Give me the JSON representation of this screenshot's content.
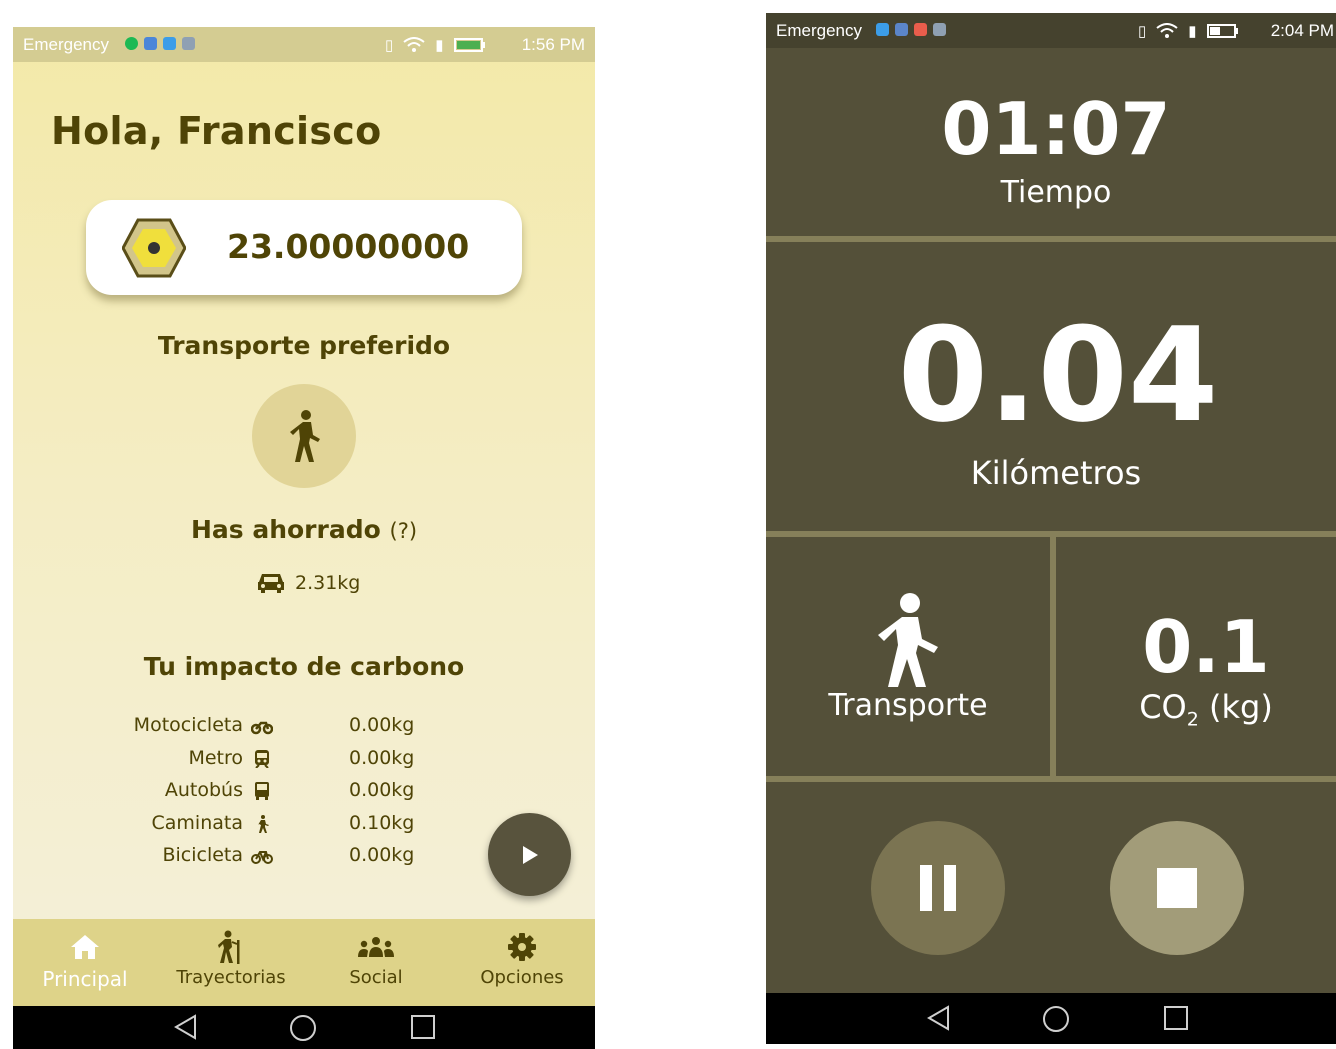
{
  "left_screen": {
    "status_bar": {
      "label": "Emergency",
      "time": "1:56 PM"
    },
    "greeting": "Hola, Francisco",
    "balance": {
      "value": "23.00000000",
      "icon": "honeycomb-coin-icon"
    },
    "preferred_transport": {
      "title": "Transporte preferido",
      "icon": "walking-icon"
    },
    "savings": {
      "title": "Has ahorrado",
      "help": "(?)",
      "value": "2.31kg",
      "icon": "car-icon"
    },
    "impact": {
      "title": "Tu impacto de carbono",
      "rows": [
        {
          "name": "Motocicleta",
          "icon": "motorcycle-icon",
          "value": "0.00kg"
        },
        {
          "name": "Metro",
          "icon": "subway-icon",
          "value": "0.00kg"
        },
        {
          "name": "Autobús",
          "icon": "bus-icon",
          "value": "0.00kg"
        },
        {
          "name": "Caminata",
          "icon": "walking-icon",
          "value": "0.10kg"
        },
        {
          "name": "Bicicleta",
          "icon": "bicycle-icon",
          "value": "0.00kg"
        }
      ]
    },
    "bottom_nav": [
      {
        "label": "Principal",
        "icon": "home-icon",
        "active": true
      },
      {
        "label": "Trayectorias",
        "icon": "hiker-icon",
        "active": false
      },
      {
        "label": "Social",
        "icon": "people-icon",
        "active": false
      },
      {
        "label": "Opciones",
        "icon": "gear-icon",
        "active": false
      }
    ],
    "colors": {
      "text": "#4f4406",
      "nav_bg": "#ded389",
      "fab": "#58533d",
      "active_label": "#ffffff"
    }
  },
  "right_screen": {
    "status_bar": {
      "label": "Emergency",
      "time": "2:04 PM"
    },
    "time": {
      "value": "01:07",
      "label": "Tiempo"
    },
    "distance": {
      "value": "0.04",
      "label": "Kilómetros"
    },
    "transport": {
      "label": "Transporte",
      "icon": "walking-icon"
    },
    "co2": {
      "value": "0.1",
      "label_prefix": "CO",
      "label_sub": "2",
      "label_suffix": " (kg)"
    },
    "controls": {
      "pause_icon": "pause-icon",
      "stop_icon": "stop-icon"
    },
    "colors": {
      "bg": "#545039",
      "divider": "#86805a",
      "pause_btn": "#7b7452",
      "stop_btn": "#a29c79"
    }
  }
}
